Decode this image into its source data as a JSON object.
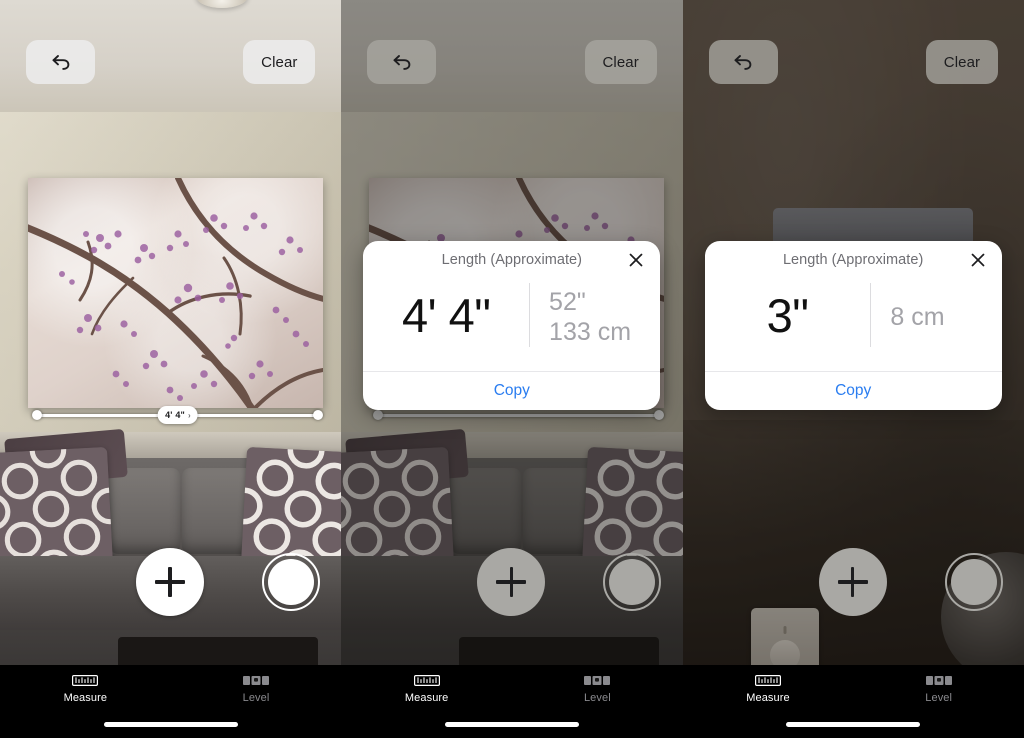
{
  "app": {
    "name": "Measure"
  },
  "panels": [
    {
      "id": "panel-1",
      "state": "measuring",
      "topbar": {
        "undo_icon": "undo-arrow-icon",
        "clear_label": "Clear"
      },
      "measurement_line": {
        "label": "4' 4\"",
        "chevron": "›"
      },
      "bottom": {
        "add_icon": "plus-icon",
        "shutter_icon": "shutter-circle-icon"
      },
      "popup": null,
      "tabs": [
        {
          "icon": "ruler-icon",
          "label": "Measure",
          "active": true
        },
        {
          "icon": "level-icon",
          "label": "Level",
          "active": false
        }
      ]
    },
    {
      "id": "panel-2",
      "state": "result-shown",
      "topbar": {
        "undo_icon": "undo-arrow-icon",
        "clear_label": "Clear"
      },
      "bottom": {
        "add_icon": "plus-icon",
        "shutter_icon": "shutter-circle-icon"
      },
      "popup": {
        "title": "Length (Approximate)",
        "close_icon": "close-x-icon",
        "primary": "4' 4\"",
        "secondary_line1": "52\"",
        "secondary_line2": "133 cm",
        "copy_label": "Copy"
      },
      "tabs": [
        {
          "icon": "ruler-icon",
          "label": "Measure",
          "active": true
        },
        {
          "icon": "level-icon",
          "label": "Level",
          "active": false
        }
      ]
    },
    {
      "id": "panel-3",
      "state": "result-shown",
      "topbar": {
        "undo_icon": "undo-arrow-icon",
        "clear_label": "Clear"
      },
      "bottom": {
        "add_icon": "plus-icon",
        "shutter_icon": "shutter-circle-icon"
      },
      "popup": {
        "title": "Length (Approximate)",
        "close_icon": "close-x-icon",
        "primary": "3\"",
        "secondary_line1": "8 cm",
        "secondary_line2": "",
        "copy_label": "Copy"
      },
      "tabs": [
        {
          "icon": "ruler-icon",
          "label": "Measure",
          "active": true
        },
        {
          "icon": "level-icon",
          "label": "Level",
          "active": false
        }
      ]
    }
  ],
  "colors": {
    "accent_link": "#2a7df0",
    "card_background": "#ffffff",
    "title_gray": "#6e6e73",
    "secondary_gray": "#a3a3a8",
    "tabbar_background": "#000000",
    "tab_active": "#ffffff",
    "tab_inactive": "#8a8a8e",
    "control_chip": "#ececec"
  }
}
